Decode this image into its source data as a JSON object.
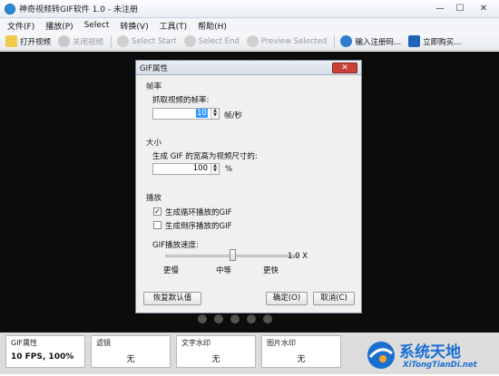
{
  "window": {
    "title": "神奇视频转GIF软件 1.0 - 未注册",
    "minimize": "—",
    "maximize": "☐",
    "close": "✕"
  },
  "menu": [
    "文件(F)",
    "播放(P)",
    "Select",
    "转换(V)",
    "工具(T)",
    "帮助(H)"
  ],
  "toolbar": {
    "open_video": "打开视频",
    "close_video": "关闭视频",
    "select_start": "Select Start",
    "select_end": "Select End",
    "preview_selected": "Preview Selected",
    "enter_reg_code": "输入注册码...",
    "buy_now": "立即购买..."
  },
  "dialog": {
    "title": "GIF属性",
    "close": "✕",
    "frame_rate_section": "帧率",
    "capture_label": "抓取视频的帧率:",
    "capture_value": "10",
    "capture_unit": "帧/秒",
    "size_section": "大小",
    "size_label": "生成 GIF 的宽高为视频尺寸的:",
    "size_value": "100",
    "size_unit": "%",
    "play_section": "播放",
    "loop_label": "生成循环播放的GIF",
    "loop_checked": true,
    "reverse_label": "生成倒序播放的GIF",
    "reverse_checked": false,
    "speed_label": "GIF播放速度:",
    "speed_value_text": "1.0 X",
    "speed_fraction": 0.5,
    "speed_slow": "更慢",
    "speed_mid": "中等",
    "speed_fast": "更快",
    "reset_button": "恢复默认值",
    "ok_button": "确定(O)",
    "cancel_button": "取消(C)"
  },
  "bottom_cards": [
    {
      "label": "GIF属性",
      "value": "10 FPS, 100%"
    },
    {
      "label": "滤镜",
      "value": "无"
    },
    {
      "label": "文字水印",
      "value": "无"
    },
    {
      "label": "图片水印",
      "value": "无"
    }
  ],
  "logo": {
    "text": "系统天地",
    "url_text": "XiTongTianDi.net"
  },
  "colors": {
    "accent": "#2a89d8",
    "preview_bg": "#0d0d0d",
    "close_red": "#c9413a",
    "logo_blue": "#1a6fd1"
  }
}
